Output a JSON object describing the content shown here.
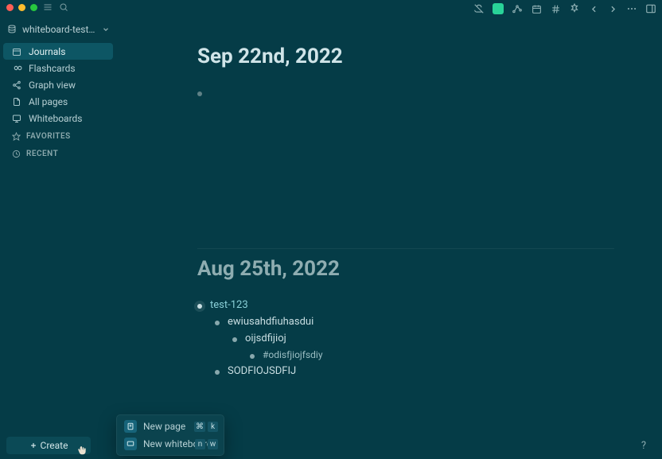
{
  "workspace": {
    "name": "whiteboard-test-g…"
  },
  "sidebar": {
    "items": [
      {
        "label": "Journals",
        "active": true
      },
      {
        "label": "Flashcards",
        "active": false
      },
      {
        "label": "Graph view",
        "active": false
      },
      {
        "label": "All pages",
        "active": false
      },
      {
        "label": "Whiteboards",
        "active": false
      }
    ],
    "sections": [
      {
        "label": "FAVORITES"
      },
      {
        "label": "RECENT"
      }
    ],
    "create_label": "Create"
  },
  "create_popup": {
    "items": [
      {
        "label": "New page",
        "kbd": [
          "⌘",
          "k"
        ]
      },
      {
        "label": "New whiteboard",
        "kbd": [
          "n",
          "w"
        ]
      }
    ]
  },
  "journals": [
    {
      "title": "Sep 22nd, 2022",
      "muted": false,
      "blocks": [
        {
          "depth": 0,
          "text": "",
          "kind": "empty"
        }
      ]
    },
    {
      "title": "Aug 25th, 2022",
      "muted": true,
      "blocks": [
        {
          "depth": 0,
          "text": "test-123",
          "kind": "link",
          "open": true
        },
        {
          "depth": 1,
          "text": "ewiusahdfiuhasdui",
          "kind": "text"
        },
        {
          "depth": 2,
          "text": "oijsdfijioj",
          "kind": "text"
        },
        {
          "depth": 3,
          "text": "#odisfjiojfsdiy",
          "kind": "tag"
        },
        {
          "depth": 1,
          "text": "SODFIOJSDFIJ",
          "kind": "text"
        }
      ]
    }
  ],
  "help_label": "?"
}
